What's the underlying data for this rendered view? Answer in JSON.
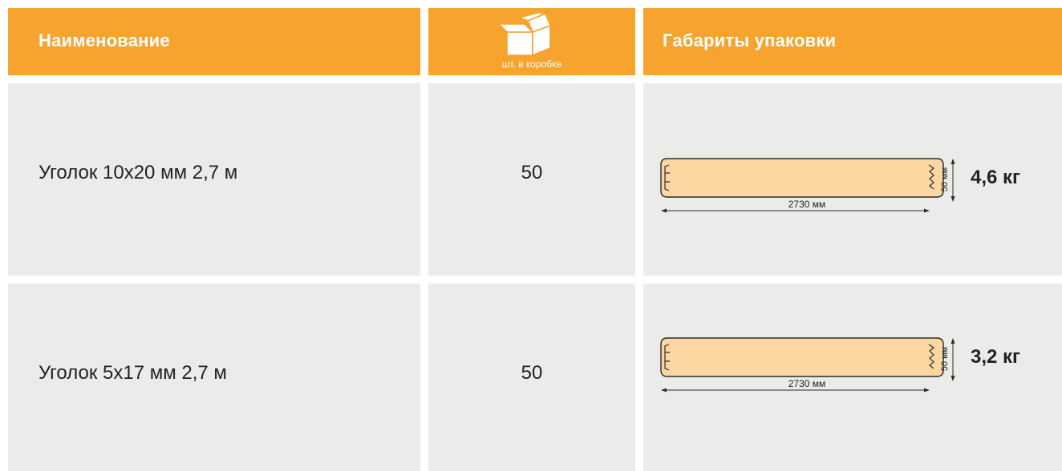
{
  "header": {
    "name_label": "Наименование",
    "qty_caption": "шт. в коробке",
    "qty_icon": "box-icon",
    "dims_label": "Габариты упаковки"
  },
  "rows": [
    {
      "name": "Уголок 10х20 мм  2,7 м",
      "qty": "50",
      "length": "2730 мм",
      "width": "50 мм",
      "weight": "4,6 кг"
    },
    {
      "name": "Уголок 5х17 мм  2,7 м",
      "qty": "50",
      "length": "2730 мм",
      "width": "50 мм",
      "weight": "3,2 кг"
    }
  ],
  "colors": {
    "header": "#F7A42E",
    "cell": "#EBEBEA",
    "package": "#FCD7A1"
  }
}
